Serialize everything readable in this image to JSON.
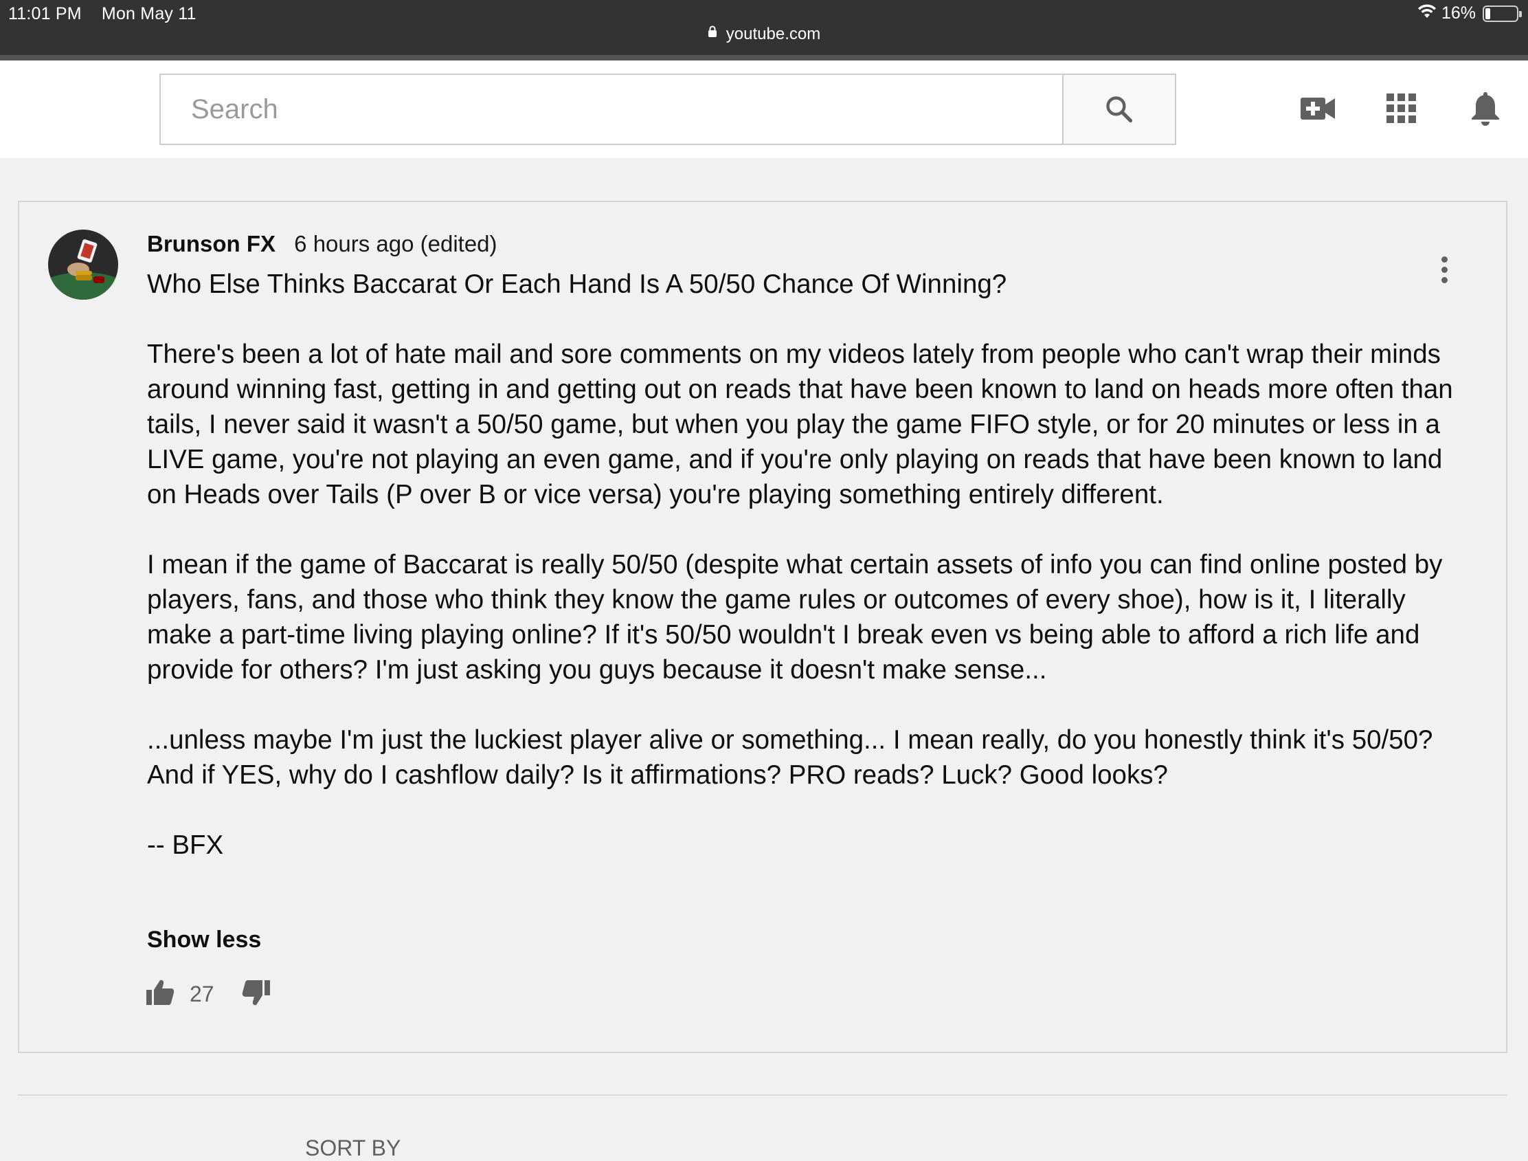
{
  "status_bar": {
    "time": "11:01 PM",
    "date": "Mon May 11",
    "battery": "16%",
    "wifi_icon": "wifi-icon",
    "battery_icon": "battery-icon"
  },
  "url_bar": {
    "url": "youtube.com",
    "lock_icon": "lock-icon"
  },
  "header": {
    "search_placeholder": "Search",
    "icons": [
      "search-icon",
      "create-video-icon",
      "apps-grid-icon",
      "notifications-bell-icon"
    ]
  },
  "comment": {
    "author": "Brunson FX",
    "timestamp": "6 hours ago (edited)",
    "paragraphs": [
      "Who Else Thinks Baccarat Or Each Hand Is A 50/50 Chance Of Winning?",
      "There's been a lot of hate mail and sore comments on my videos lately from people who can't wrap their minds around winning fast, getting in and getting out on reads that have been known to land on heads more often than tails, I never said it wasn't a 50/50 game, but when you play the game FIFO style, or for 20 minutes or less in a LIVE game, you're not playing an even game, and if you're only playing on reads that have been known to land on Heads over Tails (P over B or vice versa) you're playing something entirely different.",
      "I mean if the game of Baccarat is really 50/50 (despite what certain assets of info you can find online posted by players, fans, and those who think they know the game rules or outcomes of every shoe), how is it, I literally make a part-time living playing online? If it's 50/50 wouldn't I break even vs being able to afford a rich life and provide for others? I'm just asking you guys because it doesn't make sense...",
      "...unless maybe I'm just the luckiest player alive or something... I mean really, do you honestly think it's 50/50?  And if YES, why do I cashflow daily? Is it affirmations? PRO reads? Luck? Good looks?",
      "-- BFX"
    ],
    "show_less": "Show less",
    "like_count": "27",
    "icons": [
      "more-vert-icon",
      "thumbs-up-icon",
      "thumbs-down-icon",
      "avatar"
    ]
  },
  "below": {
    "partial_text": "SORT BY"
  }
}
